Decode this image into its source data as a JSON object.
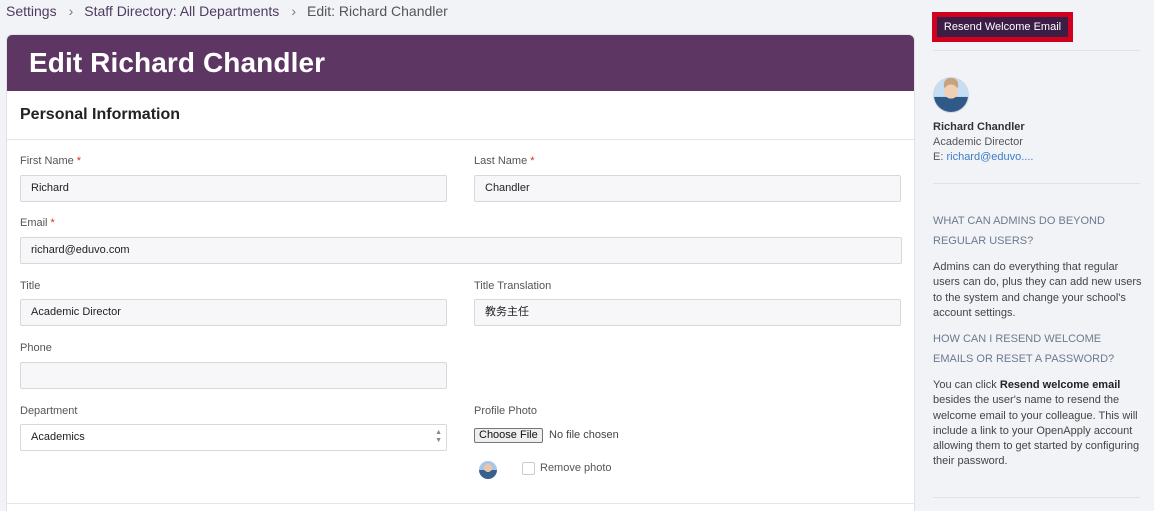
{
  "breadcrumb": {
    "items": [
      "Settings",
      "Staff Directory: All Departments",
      "Edit: Richard Chandler"
    ]
  },
  "page": {
    "title": "Edit Richard Chandler",
    "section": "Personal Information"
  },
  "form": {
    "first_name": {
      "label": "First Name",
      "value": "Richard",
      "required": true
    },
    "last_name": {
      "label": "Last Name",
      "value": "Chandler",
      "required": true
    },
    "email": {
      "label": "Email",
      "value": "richard@eduvo.com",
      "required": true
    },
    "title": {
      "label": "Title",
      "value": "Academic Director"
    },
    "title_translation": {
      "label": "Title Translation",
      "value": "教务主任"
    },
    "phone": {
      "label": "Phone",
      "value": ""
    },
    "department": {
      "label": "Department",
      "value": "Academics"
    },
    "profile_photo": {
      "label": "Profile Photo",
      "button": "Choose File",
      "status": "No file chosen",
      "remove_label": "Remove photo",
      "remove_checked": false
    },
    "required_marker": "*"
  },
  "sidebar": {
    "resend_button": "Resend Welcome Email",
    "profile": {
      "name": "Richard Chandler",
      "title": "Academic Director",
      "email_prefix": "E:",
      "email_display": "richard@eduvo...."
    },
    "faq": [
      {
        "question": "WHAT CAN ADMINS DO BEYOND REGULAR USERS?",
        "answer": "Admins can do everything that regular users can do, plus they can add new users to the system and change your school's account settings."
      },
      {
        "question": "HOW CAN I RESEND WELCOME EMAILS OR RESET A PASSWORD?",
        "answer_prefix": "You can click",
        "answer_bold": "Resend welcome email",
        "answer_suffix": "besides the user's name to resend the welcome email to your colleague. This will include a link to your OpenApply account allowing them to get started by configuring their password."
      }
    ]
  },
  "colors": {
    "header_bg": "#5e3664",
    "button_bg": "#3b1d45",
    "highlight": "#d1001f",
    "link": "#3d7cc9",
    "required": "#d9302c"
  },
  "icons": [
    "chevron-right-icon",
    "select-stepper-icon",
    "avatar-icon"
  ]
}
